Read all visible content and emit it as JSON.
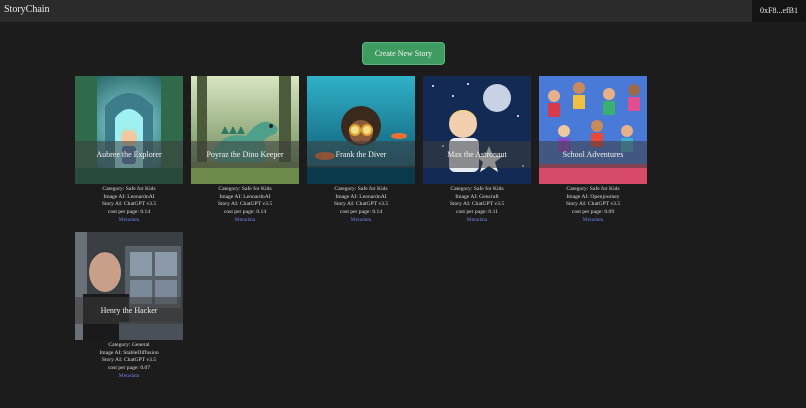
{
  "header": {
    "brand": "StoryChain",
    "wallet": "0xF8...efB1"
  },
  "actions": {
    "create_label": "Create New Story"
  },
  "stories": [
    {
      "title": "Aubree the Explorer",
      "category": "Category: Safe for Kids",
      "image_ai": "Image AI: LeonardoAI",
      "story_ai": "Story AI: ChatGPT v3.5",
      "cost": "cost per page: 0.14",
      "link": "Metadata"
    },
    {
      "title": "Poyraz the Dino Keeper",
      "category": "Category: Safe for Kids",
      "image_ai": "Image AI: LeonardoAI",
      "story_ai": "Story AI: ChatGPT v3.5",
      "cost": "cost per page: 0.14",
      "link": "Metadata"
    },
    {
      "title": "Frank the Diver",
      "category": "Category: Safe for Kids",
      "image_ai": "Image AI: LeonardoAI",
      "story_ai": "Story AI: ChatGPT v3.5",
      "cost": "cost per page: 0.14",
      "link": "Metadata"
    },
    {
      "title": "Max the Astronaut",
      "category": "Category: Safe for Kids",
      "image_ai": "Image AI: Gencraft",
      "story_ai": "Story AI: ChatGPT v3.5",
      "cost": "cost per page: 0.11",
      "link": "Metadata"
    },
    {
      "title": "School Adventures",
      "category": "Category: Safe for Kids",
      "image_ai": "Image AI: Openjourney",
      "story_ai": "Story AI: ChatGPT v3.5",
      "cost": "cost per page: 0.09",
      "link": "Metadata"
    },
    {
      "title": "Henry the Hacker",
      "category": "Category: General",
      "image_ai": "Image AI: StableDiffusion",
      "story_ai": "Story AI: ChatGPT v3.5",
      "cost": "cost per page: 0.07",
      "link": "Metadata"
    }
  ]
}
